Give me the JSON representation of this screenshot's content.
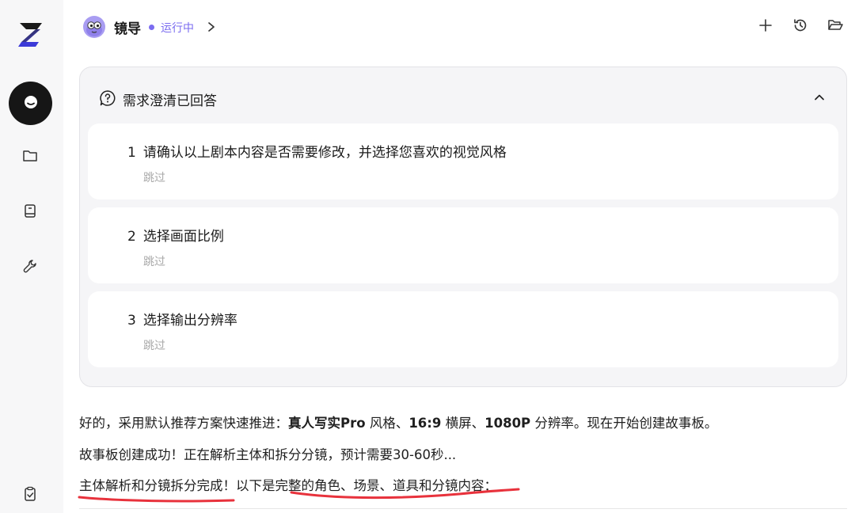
{
  "sidebar": {
    "items": [
      {
        "name": "chat",
        "icon": "chat-icon"
      },
      {
        "name": "folder",
        "icon": "folder-icon"
      },
      {
        "name": "library",
        "icon": "book-icon"
      },
      {
        "name": "tools",
        "icon": "wrench-icon"
      },
      {
        "name": "tasks",
        "icon": "clipboard-check-icon"
      }
    ]
  },
  "header": {
    "agent_name": "镜导",
    "status": "运行中",
    "actions": [
      "plus-icon",
      "history-icon",
      "folder-open-icon"
    ]
  },
  "clarification": {
    "title": "需求澄清已回答",
    "questions": [
      {
        "num": "1",
        "text": "请确认以上剧本内容是否需要修改，并选择您喜欢的视觉风格",
        "answer": "跳过"
      },
      {
        "num": "2",
        "text": "选择画面比例",
        "answer": "跳过"
      },
      {
        "num": "3",
        "text": "选择输出分辨率",
        "answer": "跳过"
      }
    ]
  },
  "messages": {
    "m1_prefix": "好的，采用默认推荐方案快速推进：",
    "m1_bold1": "真人写实Pro",
    "m1_mid1": " 风格、",
    "m1_bold2": "16:9",
    "m1_mid2": " 横屏、",
    "m1_bold3": "1080P",
    "m1_suffix": " 分辨率。现在开始创建故事板。",
    "m2": "故事板创建成功！正在解析主体和拆分分镜，预计需要30-60秒...",
    "m3": "主体解析和分镜拆分完成！以下是完整的角色、场景、道具和分镜内容："
  },
  "colors": {
    "accent": "#7b6cf0",
    "annotation": "#e8323c",
    "nav_active": "#161616"
  }
}
